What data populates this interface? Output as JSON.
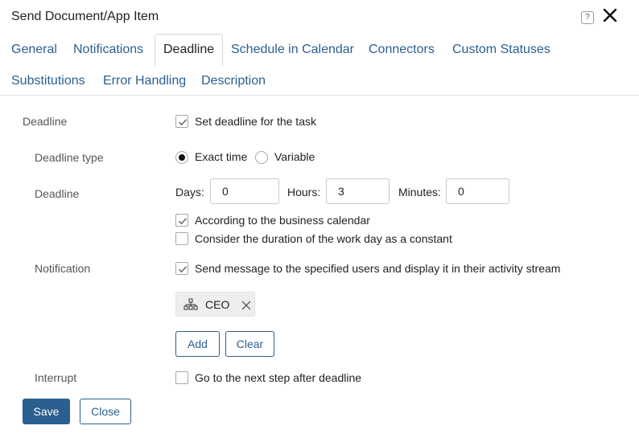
{
  "window": {
    "title": "Send Document/App Item",
    "help_label": "?"
  },
  "tabs": [
    {
      "label": "General"
    },
    {
      "label": "Notifications"
    },
    {
      "label": "Deadline"
    },
    {
      "label": "Schedule in Calendar"
    },
    {
      "label": "Connectors"
    },
    {
      "label": "Custom Statuses"
    },
    {
      "label": "Substitutions"
    },
    {
      "label": "Error Handling"
    },
    {
      "label": "Description"
    }
  ],
  "active_tab": "Deadline",
  "form": {
    "deadline_section_label": "Deadline",
    "set_deadline_label": "Set deadline for the task",
    "set_deadline_checked": true,
    "deadline_type_label": "Deadline type",
    "exact_time_label": "Exact time",
    "variable_label": "Variable",
    "deadline_type_selected": "Exact time",
    "deadline_label": "Deadline",
    "days_label": "Days:",
    "days_value": "0",
    "hours_label": "Hours:",
    "hours_value": "3",
    "minutes_label": "Minutes:",
    "minutes_value": "0",
    "business_calendar_label": "According to the business calendar",
    "business_calendar_checked": true,
    "constant_workday_label": "Consider the duration of the work day as a constant",
    "constant_workday_checked": false,
    "notification_label": "Notification",
    "send_message_label": "Send message to the specified users and display it in their activity stream",
    "send_message_checked": true,
    "recipient_chip": "CEO",
    "add_label": "Add",
    "clear_label": "Clear",
    "interrupt_label": "Interrupt",
    "next_step_label": "Go to the next step after deadline",
    "next_step_checked": false
  },
  "footer": {
    "save_label": "Save",
    "close_label": "Close"
  },
  "colors": {
    "accent": "#2a5f8f",
    "link": "#2a5f8f",
    "border": "#c9c9c9"
  }
}
